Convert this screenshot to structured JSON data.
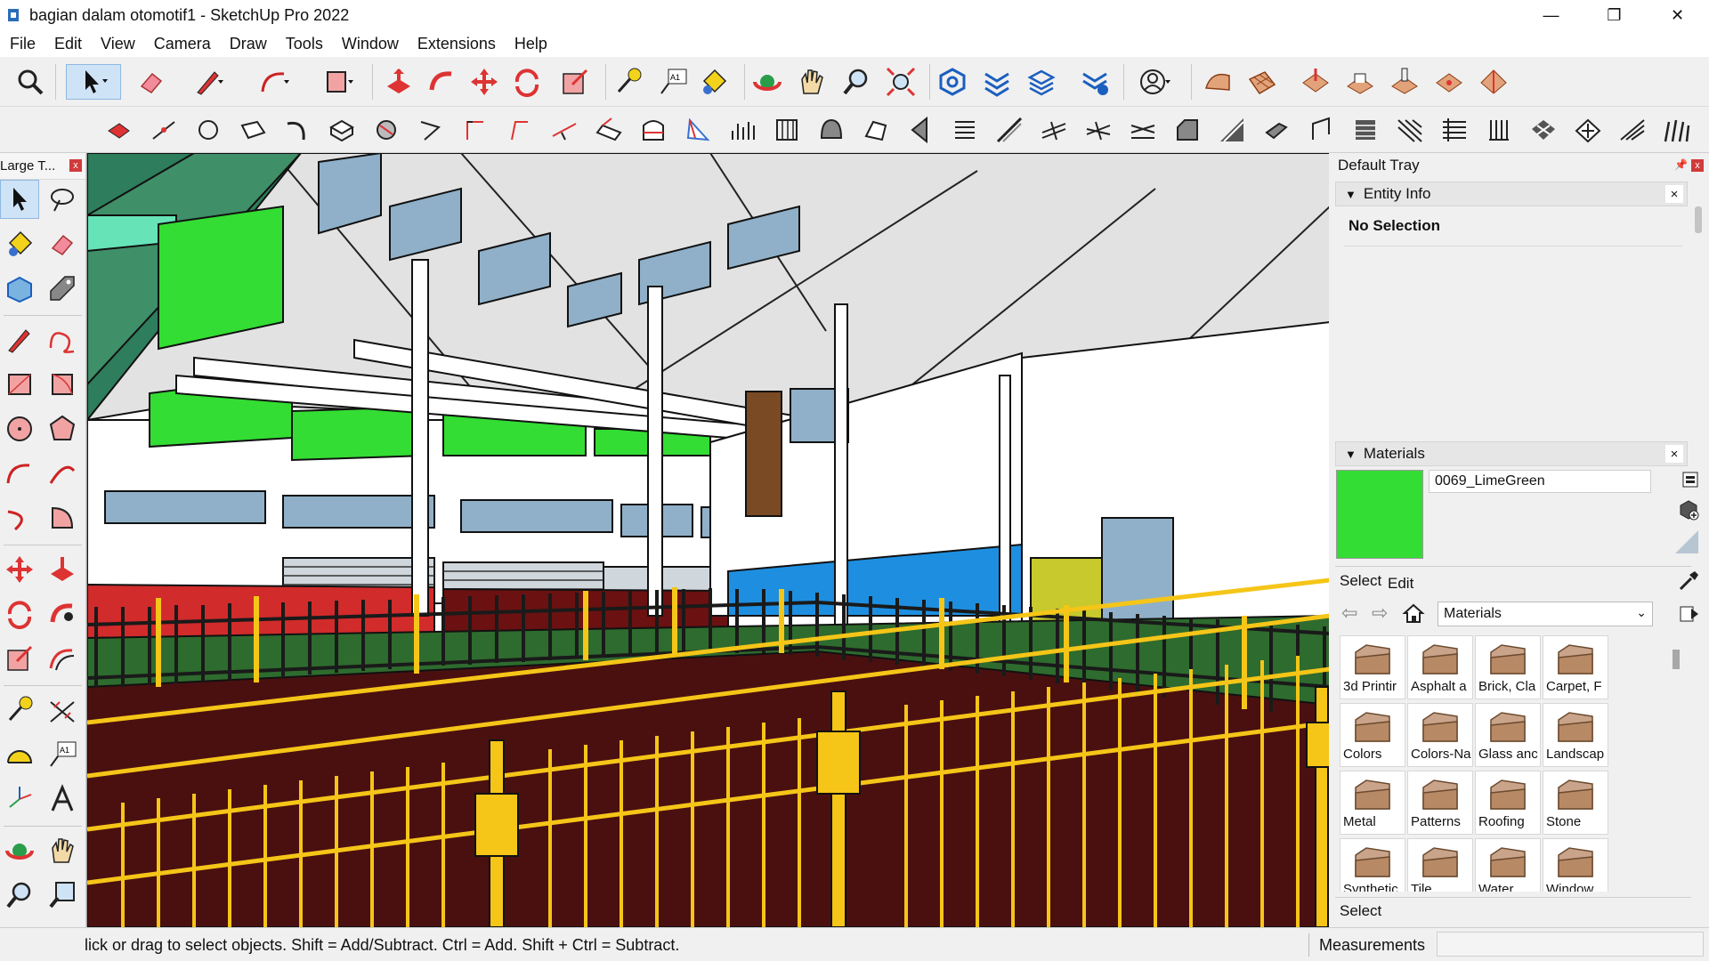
{
  "window": {
    "title": "bagian dalam otomotif1 - SketchUp Pro 2022",
    "minimize": "—",
    "restore": "❐",
    "close": "✕"
  },
  "menu": [
    "File",
    "Edit",
    "View",
    "Camera",
    "Draw",
    "Tools",
    "Window",
    "Extensions",
    "Help"
  ],
  "left_toolbar": {
    "title": "Large T...",
    "close": "x"
  },
  "tray": {
    "title": "Default Tray",
    "entity_info": {
      "title": "Entity Info",
      "selection": "No Selection"
    },
    "materials": {
      "title": "Materials",
      "current_name": "0069_LimeGreen",
      "current_color": "#33dd33",
      "tab_select": "Select",
      "tab_edit": "Edit",
      "library": "Materials",
      "folders": [
        "3d Printir",
        "Asphalt a",
        "Brick, Cla",
        "Carpet, F",
        "Colors",
        "Colors-Na",
        "Glass anc",
        "Landscap",
        "Metal",
        "Patterns",
        "Roofing",
        "Stone",
        "Synthetic",
        "Tile",
        "Water",
        "Window"
      ],
      "footer": "Select"
    }
  },
  "status": {
    "hint": "lick or drag to select objects. Shift = Add/Subtract. Ctrl = Add. Shift + Ctrl = Subtract.",
    "measurements_label": "Measurements"
  },
  "colors": {
    "floor": "#4a1010",
    "fence_yellow": "#f5c518",
    "wall_green": "#33dd33",
    "wall_red": "#d12b2b",
    "wall_blue": "#1e8fe0",
    "ceiling": "#e2e2e2"
  }
}
